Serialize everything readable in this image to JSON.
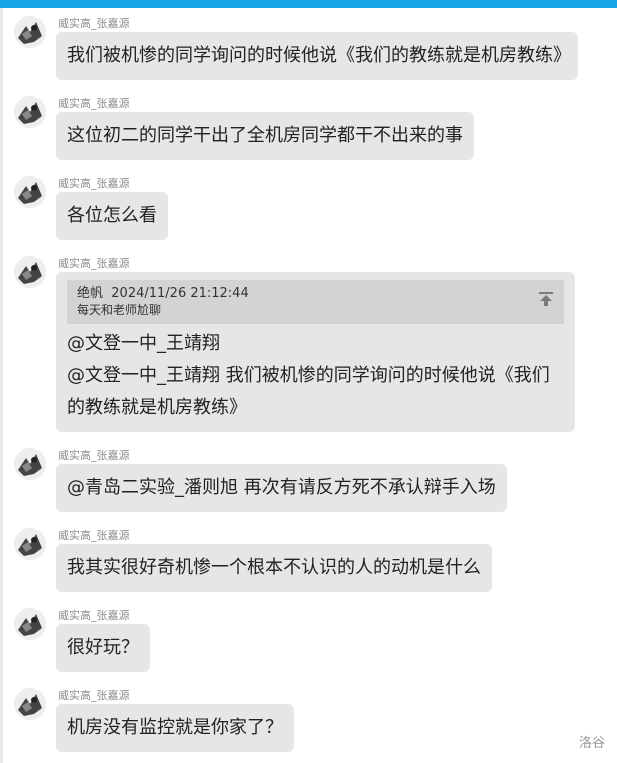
{
  "header_color": "#17a6ea",
  "messages": [
    {
      "sender": "威实高_张嘉源",
      "text": "我们被机惨的同学询问的时候他说《我们的教练就是机房教练》"
    },
    {
      "sender": "威实高_张嘉源",
      "text": "这位初二的同学干出了全机房同学都干不出来的事"
    },
    {
      "sender": "威实高_张嘉源",
      "text": "各位怎么看"
    },
    {
      "sender": "威实高_张嘉源",
      "quote": {
        "author": "绝帆",
        "time": "2024/11/26 21:12:44",
        "text": "每天和老师尬聊",
        "icon": "pin-top-icon"
      },
      "line1": "@文登一中_王靖翔",
      "line2": " @文登一中_王靖翔 我们被机惨的同学询问的时候他说《我们的教练就是机房教练》"
    },
    {
      "sender": "威实高_张嘉源",
      "text": "@青岛二实验_潘则旭  再次有请反方死不承认辩手入场"
    },
    {
      "sender": "威实高_张嘉源",
      "text": "我其实很好奇机惨一个根本不认识的人的动机是什么"
    },
    {
      "sender": "威实高_张嘉源",
      "text": "很好玩？"
    },
    {
      "sender": "威实高_张嘉源",
      "text": "机房没有监控就是你家了？"
    }
  ],
  "footer": {
    "watermark": "洛谷"
  }
}
